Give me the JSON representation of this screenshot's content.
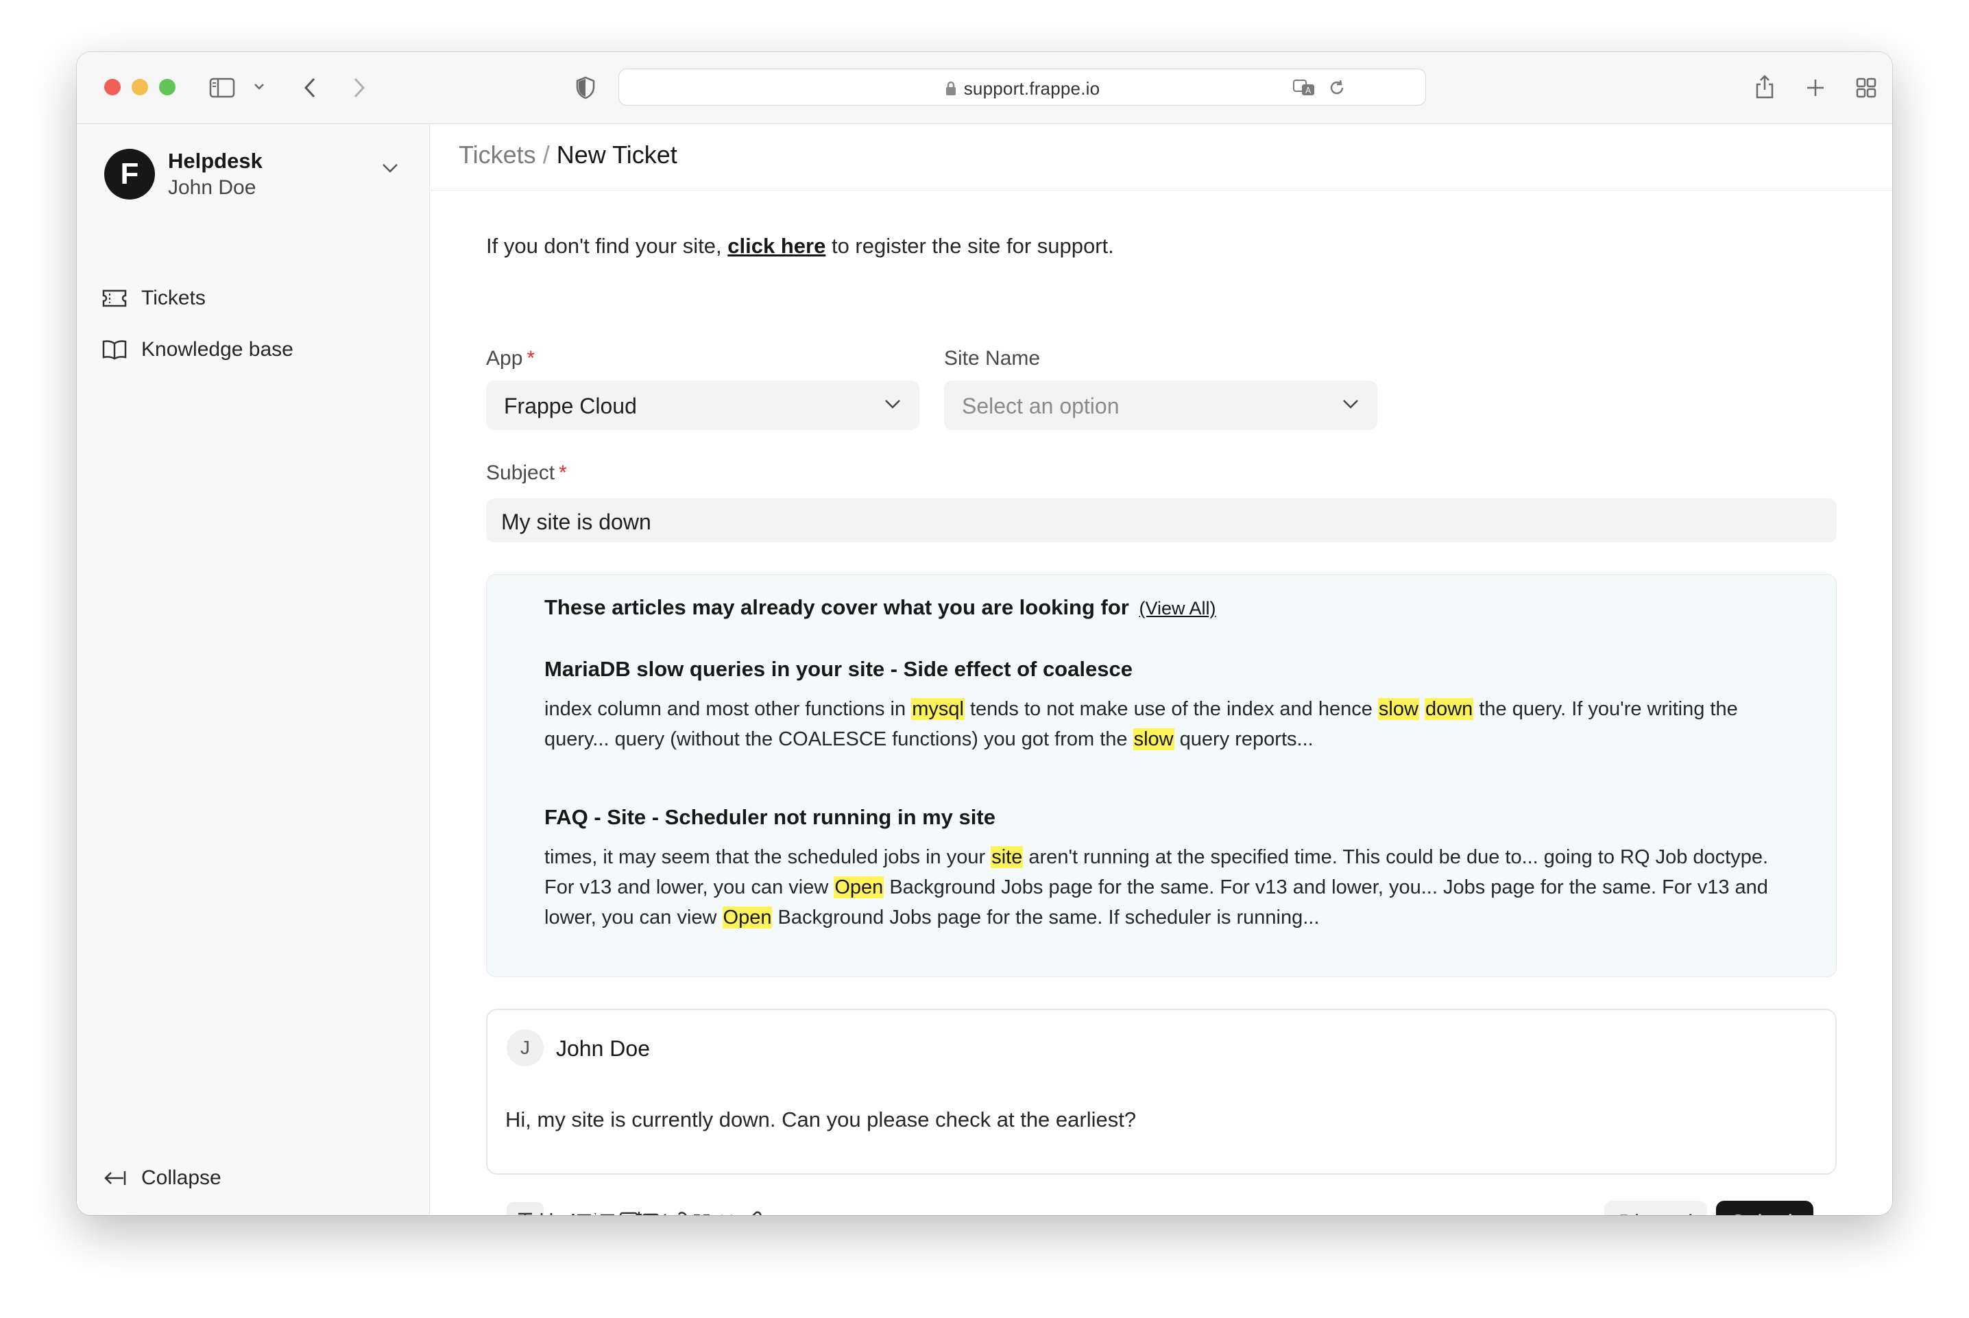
{
  "browser": {
    "url": "support.frappe.io"
  },
  "sidebar": {
    "brand_title": "Helpdesk",
    "brand_user": "John Doe",
    "logo_letter": "F",
    "items": [
      {
        "label": "Tickets",
        "icon": "ticket-icon"
      },
      {
        "label": "Knowledge base",
        "icon": "book-icon"
      }
    ],
    "collapse_label": "Collapse"
  },
  "header": {
    "breadcrumb_parent": "Tickets",
    "breadcrumb_separator": "/",
    "breadcrumb_current": "New Ticket"
  },
  "form": {
    "notice_before": "If you don't find your site,",
    "notice_link": "click here",
    "notice_after": "to register the site for support.",
    "app_label": "App",
    "required_mark": "*",
    "app_value": "Frappe Cloud",
    "site_label": "Site Name",
    "site_placeholder": "Select an option",
    "subject_label": "Subject",
    "subject_value": "My site is down"
  },
  "articles": {
    "heading": "These articles may already cover what you are looking for",
    "view_all": "(View All)",
    "items": [
      {
        "title": "MariaDB slow queries in your site - Side effect of coalesce",
        "segments": [
          {
            "text": "index column and most other functions in ",
            "highlight": false
          },
          {
            "text": "mysql",
            "highlight": true
          },
          {
            "text": " tends to not make use of the index and hence ",
            "highlight": false
          },
          {
            "text": "slow",
            "highlight": true
          },
          {
            "text": " ",
            "highlight": false
          },
          {
            "text": "down",
            "highlight": true
          },
          {
            "text": " the query. If you're writing the query... query (without the COALESCE functions) you got from the ",
            "highlight": false
          },
          {
            "text": "slow",
            "highlight": true
          },
          {
            "text": " query reports...",
            "highlight": false
          }
        ]
      },
      {
        "title": "FAQ - Site - Scheduler not running in my site",
        "segments": [
          {
            "text": "times, it may seem that the scheduled jobs in your ",
            "highlight": false
          },
          {
            "text": "site",
            "highlight": true
          },
          {
            "text": " aren't running at the specified time. This could be due to... going to RQ Job doctype. For v13 and lower, you can view ",
            "highlight": false
          },
          {
            "text": "Open",
            "highlight": true
          },
          {
            "text": " Background Jobs page for the same. For v13 and lower, you... Jobs page for the same. For v13 and lower, you can view ",
            "highlight": false
          },
          {
            "text": "Open",
            "highlight": true
          },
          {
            "text": " Background Jobs page for the same. If scheduler is running...",
            "highlight": false
          }
        ]
      }
    ]
  },
  "composer": {
    "avatar_letter": "J",
    "author": "John Doe",
    "text": "Hi, my site is currently down. Can you please check at the earliest?"
  },
  "editor_toolbar": {
    "buttons": [
      "text-icon",
      "heading-icon",
      "bullet-list-icon",
      "numbered-list-icon",
      "image-icon",
      "video-icon",
      "link-icon",
      "quote-icon",
      "code-icon",
      "attachment-icon"
    ],
    "discard_label": "Discard",
    "submit_label": "Submit"
  },
  "colors": {
    "highlight": "#fff35a",
    "required": "#e03131",
    "primary": "#171717"
  }
}
